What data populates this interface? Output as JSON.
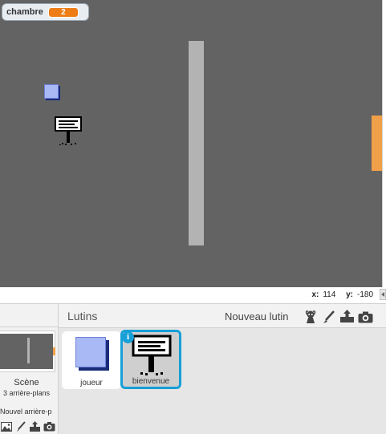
{
  "stage": {
    "variable_monitor": {
      "name": "chambre",
      "value": "2"
    }
  },
  "info_bar": {
    "x_label": "x:",
    "x_value": "114",
    "y_label": "y:",
    "y_value": "-180"
  },
  "scene": {
    "label": "Scène",
    "sublabel": "3 arrière-plans",
    "new_backdrop_label": "Nouvel arrière-p",
    "tools": [
      "image-icon",
      "paintbrush-icon",
      "upload-icon",
      "camera-icon"
    ]
  },
  "sprites": {
    "title": "Lutins",
    "new_sprite_label": "Nouveau lutin",
    "tools": [
      "character-icon",
      "paintbrush-icon",
      "upload-icon",
      "camera-icon"
    ],
    "items": [
      {
        "name": "joueur",
        "selected": false
      },
      {
        "name": "bienvenue",
        "selected": true
      }
    ]
  },
  "colors": {
    "stage_bg": "#636363",
    "wall": "#b3b3b3",
    "door": "#f0a048",
    "variable_value_bg": "#ee7d16",
    "selection_border": "#179fd7",
    "player_light": "#a9b9f6",
    "player_dark": "#1a2b7a"
  }
}
